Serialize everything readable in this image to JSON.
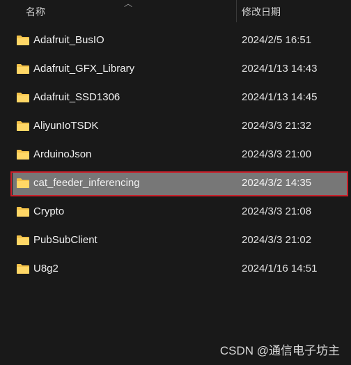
{
  "header": {
    "name_col": "名称",
    "date_col": "修改日期",
    "sort_icon": "chevron-up-icon"
  },
  "files": [
    {
      "name": "Adafruit_BusIO",
      "modified": "2024/2/5 16:51",
      "type": "folder"
    },
    {
      "name": "Adafruit_GFX_Library",
      "modified": "2024/1/13 14:43",
      "type": "folder"
    },
    {
      "name": "Adafruit_SSD1306",
      "modified": "2024/1/13 14:45",
      "type": "folder"
    },
    {
      "name": "AliyunIoTSDK",
      "modified": "2024/3/3 21:32",
      "type": "folder"
    },
    {
      "name": "ArduinoJson",
      "modified": "2024/3/3 21:00",
      "type": "folder"
    },
    {
      "name": "cat_feeder_inferencing",
      "modified": "2024/3/2 14:35",
      "type": "folder",
      "selected": true
    },
    {
      "name": "Crypto",
      "modified": "2024/3/3 21:08",
      "type": "folder"
    },
    {
      "name": "PubSubClient",
      "modified": "2024/3/3 21:02",
      "type": "folder"
    },
    {
      "name": "U8g2",
      "modified": "2024/1/16 14:51",
      "type": "folder"
    }
  ],
  "watermark": "CSDN @通信电子坊主",
  "colors": {
    "background": "#191919",
    "selection": "#777777",
    "highlight_frame": "#c8202a",
    "folder": "#f3c24a"
  }
}
